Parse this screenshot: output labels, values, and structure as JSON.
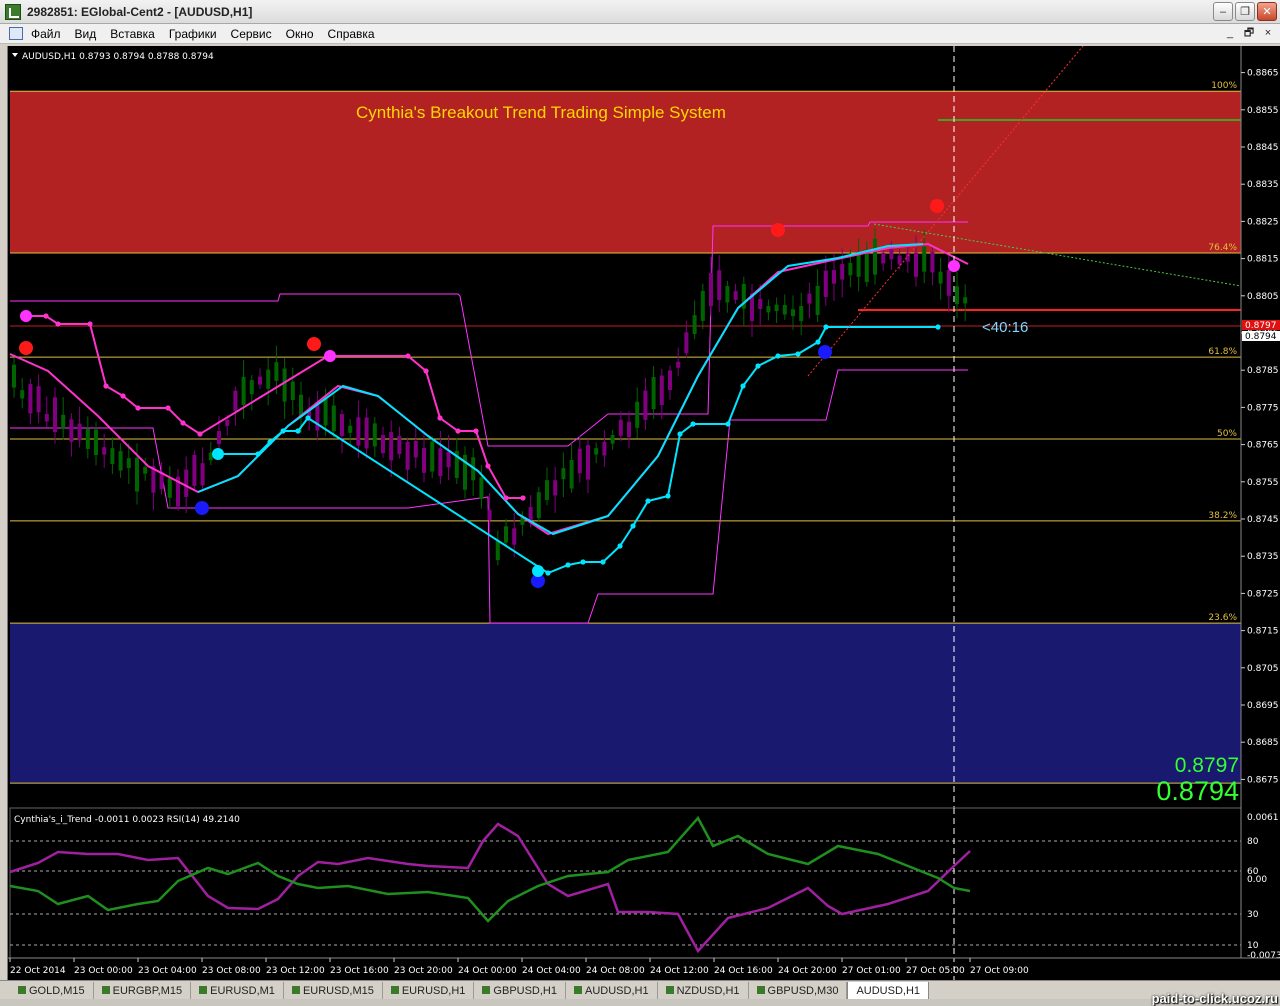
{
  "window": {
    "title": "2982851: EGlobal-Cent2 - [AUDUSD,H1]"
  },
  "menu": {
    "items": [
      "Файл",
      "Вид",
      "Вставка",
      "Графики",
      "Сервис",
      "Окно",
      "Справка"
    ]
  },
  "window_buttons": {
    "minimize": "–",
    "restore": "❐",
    "close": "✕"
  },
  "mdi_buttons": {
    "minimize": "_",
    "restore": "🗗",
    "close": "×"
  },
  "chart": {
    "header": "AUDUSD,H1  0.8793 0.8794 0.8788 0.8794",
    "title": "Cynthia's Breakout Trend Trading Simple System",
    "timer": "<40:16",
    "bid": "0.8797",
    "ask": "0.8794",
    "price_tag_bid": "0.8797",
    "price_tag_ask": "0.8794",
    "colors": {
      "upper_zone": "#b22222",
      "lower_zone": "#191970",
      "bull_candle": "#006400",
      "bear_candle": "#800080",
      "cyan": "#00e5ff",
      "magenta": "#ff00ff",
      "fib": "#e0c040",
      "price_text": "#33ff33"
    }
  },
  "fib_levels": [
    {
      "label": "100%",
      "price": 0.886
    },
    {
      "label": "76.4%",
      "price": 0.88165
    },
    {
      "label": "61.8%",
      "price": 0.87885
    },
    {
      "label": "50%",
      "price": 0.87665
    },
    {
      "label": "38.2%",
      "price": 0.87445
    },
    {
      "label": "23.6%",
      "price": 0.8717
    }
  ],
  "price_axis": [
    "0.8865",
    "0.8855",
    "0.8845",
    "0.8835",
    "0.8825",
    "0.8815",
    "0.8805",
    "0.8795",
    "0.8785",
    "0.8775",
    "0.8765",
    "0.8755",
    "0.8745",
    "0.8735",
    "0.8725",
    "0.8715",
    "0.8705",
    "0.8695",
    "0.8685",
    "0.8675"
  ],
  "time_axis": [
    "22 Oct 2014",
    "23 Oct 00:00",
    "23 Oct 04:00",
    "23 Oct 08:00",
    "23 Oct 12:00",
    "23 Oct 16:00",
    "23 Oct 20:00",
    "24 Oct 00:00",
    "24 Oct 04:00",
    "24 Oct 08:00",
    "24 Oct 12:00",
    "24 Oct 16:00",
    "24 Oct 20:00",
    "27 Oct 01:00",
    "27 Oct 05:00",
    "27 Oct 09:00"
  ],
  "indicator": {
    "header": "Cynthia's_i_Trend -0.0011 0.0023  RSI(14) 49.2140",
    "axis": [
      "0.0061",
      "80",
      "60",
      "0.00",
      "30",
      "10",
      "-0.0073"
    ]
  },
  "tabs": [
    {
      "label": "GOLD,M15",
      "active": false
    },
    {
      "label": "EURGBP,M15",
      "active": false
    },
    {
      "label": "EURUSD,M1",
      "active": false
    },
    {
      "label": "EURUSD,M15",
      "active": false
    },
    {
      "label": "EURUSD,H1",
      "active": false
    },
    {
      "label": "GBPUSD,H1",
      "active": false
    },
    {
      "label": "AUDUSD,H1",
      "active": false
    },
    {
      "label": "NZDUSD,H1",
      "active": false
    },
    {
      "label": "GBPUSD,M30",
      "active": false
    },
    {
      "label": "AUDUSD,H1",
      "active": true
    }
  ],
  "watermark": "paid-to-click.ucoz.ru"
}
